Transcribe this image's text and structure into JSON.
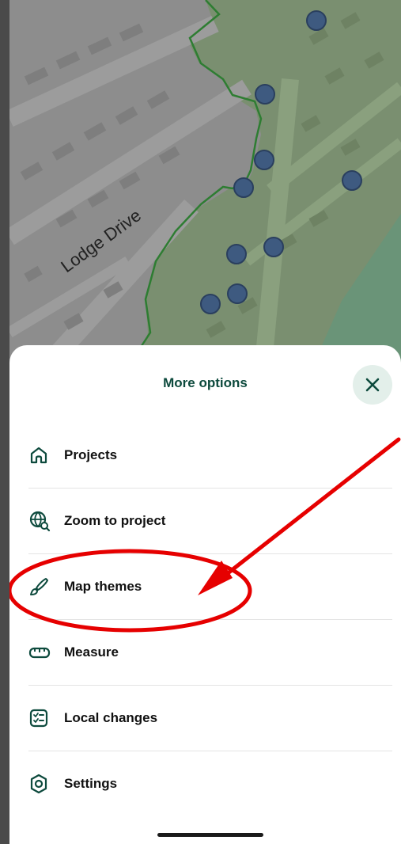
{
  "map": {
    "street_label": "Lodge Drive",
    "point_icon": "map-point-marker"
  },
  "sheet": {
    "title": "More options",
    "close_icon": "close-icon",
    "items": [
      {
        "label": "Projects",
        "icon": "home-icon"
      },
      {
        "label": "Zoom to project",
        "icon": "globe-zoom-icon"
      },
      {
        "label": "Map themes",
        "icon": "brush-icon"
      },
      {
        "label": "Measure",
        "icon": "ruler-icon"
      },
      {
        "label": "Local changes",
        "icon": "checklist-icon"
      },
      {
        "label": "Settings",
        "icon": "settings-icon"
      }
    ]
  },
  "colors": {
    "accent": "#0d4a3d",
    "annotation": "#e60000",
    "map_marker": "#3e5a80",
    "boundary": "#2e7d32"
  }
}
